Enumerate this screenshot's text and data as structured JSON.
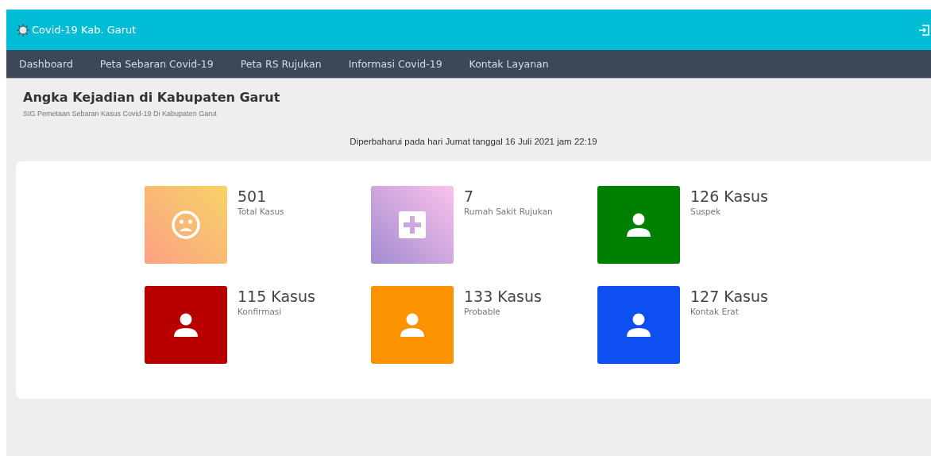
{
  "header": {
    "title": "Covid-19 Kab. Garut"
  },
  "nav": [
    {
      "label": "Dashboard"
    },
    {
      "label": "Peta Sebaran Covid-19"
    },
    {
      "label": "Peta RS Rujukan"
    },
    {
      "label": "Informasi Covid-19"
    },
    {
      "label": "Kontak Layanan"
    }
  ],
  "page": {
    "title": "Angka Kejadian di Kabupaten Garut",
    "subtitle": "SIG Pemetaan Sebaran Kasus Covid-19 Di Kabupaten Garut",
    "updated": "Diperbaharui pada hari Jumat tanggal 16 Juli 2021 jam 22:19"
  },
  "stats": [
    {
      "value": "501",
      "label": "Total Kasus",
      "kind": "sad",
      "color": "#fda085"
    },
    {
      "value": "7",
      "label": "Rumah Sakit Rujukan",
      "kind": "hospital",
      "color": "#a18cd1"
    },
    {
      "value": "126 Kasus",
      "label": "Suspek",
      "kind": "person",
      "color": "#008000"
    },
    {
      "value": "115 Kasus",
      "label": "Konfirmasi",
      "kind": "person",
      "color": "#b80000"
    },
    {
      "value": "133 Kasus",
      "label": "Probable",
      "kind": "person",
      "color": "#fb9300"
    },
    {
      "value": "127 Kasus",
      "label": "Kontak Erat",
      "kind": "person",
      "color": "#0d4ff0"
    }
  ]
}
